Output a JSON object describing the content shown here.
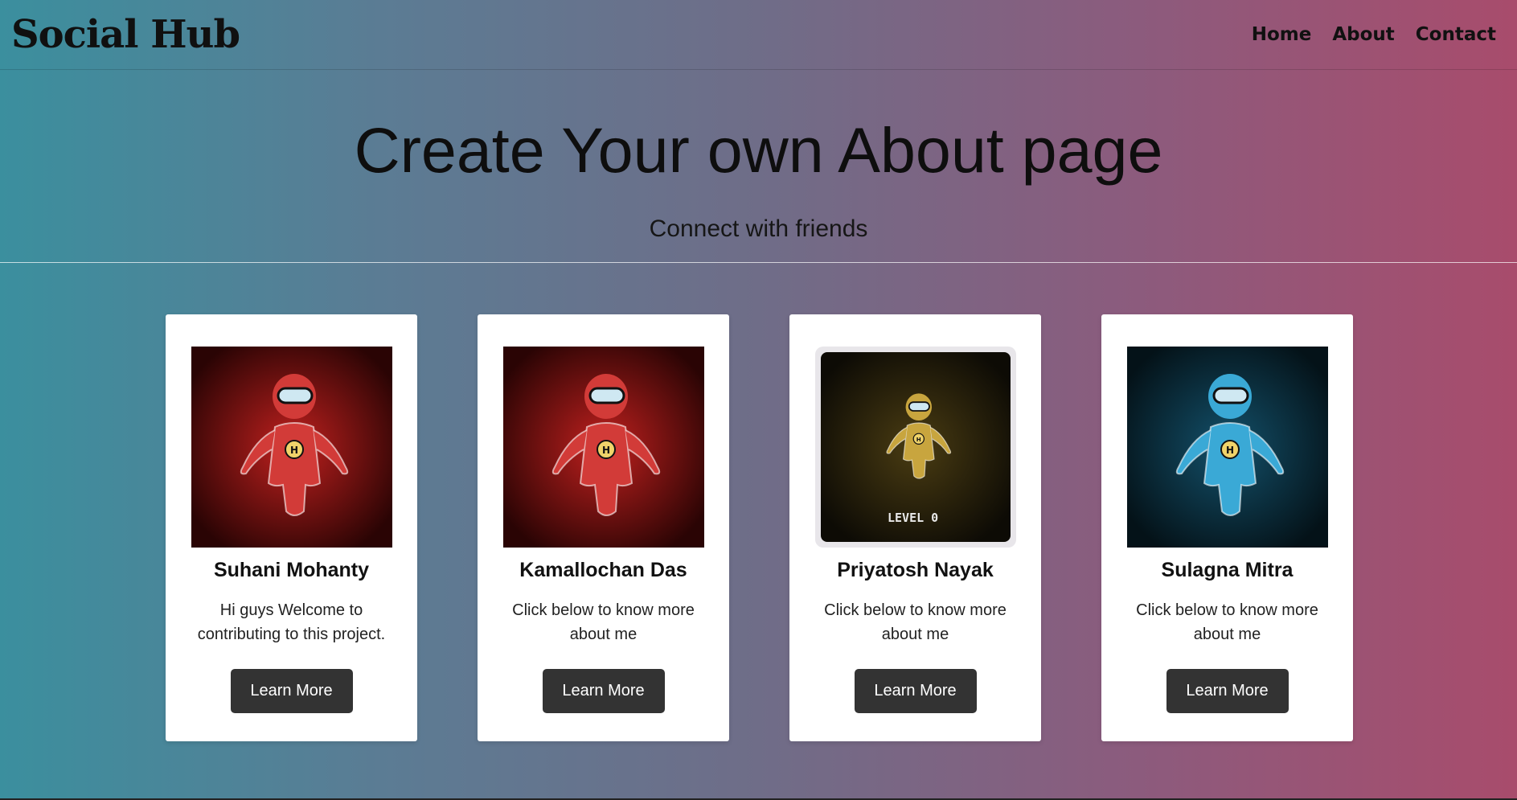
{
  "header": {
    "logo": "Social Hub",
    "nav": [
      "Home",
      "About",
      "Contact"
    ]
  },
  "hero": {
    "title": "Create Your own About page",
    "subtitle": "Connect with friends"
  },
  "cards": [
    {
      "name": "Suhani Mohanty",
      "text": "Hi guys Welcome to contributing to this project.",
      "button": "Learn More",
      "avatar": "red-astronaut-icon"
    },
    {
      "name": "Kamallochan Das",
      "text": "Click below to know more about me",
      "button": "Learn More",
      "avatar": "red-astronaut-icon"
    },
    {
      "name": "Priyatosh Nayak",
      "text": "Click below to know more about me",
      "button": "Learn More",
      "avatar": "gold-astronaut-icon",
      "badge": "LEVEL 0"
    },
    {
      "name": "Sulagna Mitra",
      "text": "Click below to know more about me",
      "button": "Learn More",
      "avatar": "blue-astronaut-icon"
    }
  ],
  "colors": {
    "gradient_start": "#3b8f9e",
    "gradient_end": "#a84c6c",
    "button_bg": "#333333"
  }
}
